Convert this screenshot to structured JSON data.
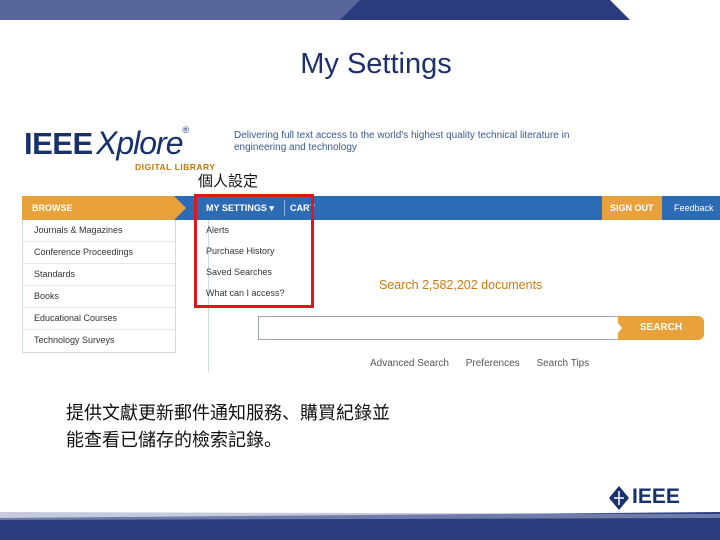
{
  "slide": {
    "title": "My Settings",
    "annotation": "個人設定",
    "description": "提供文獻更新郵件通知服務、購買紀錄並能查看已儲存的檢索記錄。"
  },
  "xplore": {
    "brand_ieee": "IEEE",
    "brand_xplore": "Xplore",
    "brand_reg": "®",
    "digital_library": "DIGITAL LIBRARY",
    "tagline": "Delivering full text access to the world's highest quality technical literature in engineering and technology",
    "nav": {
      "browse": "BROWSE",
      "my_settings": "MY SETTINGS",
      "cart": "CART",
      "sign_out": "SIGN OUT",
      "feedback": "Feedback"
    },
    "browse_items": [
      "Journals & Magazines",
      "Conference Proceedings",
      "Standards",
      "Books",
      "Educational Courses",
      "Technology Surveys"
    ],
    "settings_items": [
      "Alerts",
      "Purchase History",
      "Saved Searches",
      "What can I access?"
    ],
    "search": {
      "count_text": "Search 2,582,202 documents",
      "button": "SEARCH",
      "advanced": "Advanced Search",
      "preferences": "Preferences",
      "tips": "Search Tips"
    }
  },
  "footer": {
    "logo_text": "IEEE"
  },
  "colors": {
    "navy": "#1f2f6e",
    "nav_blue": "#2d6bb4",
    "orange": "#e9a23b",
    "highlight_red": "#e0161d"
  }
}
